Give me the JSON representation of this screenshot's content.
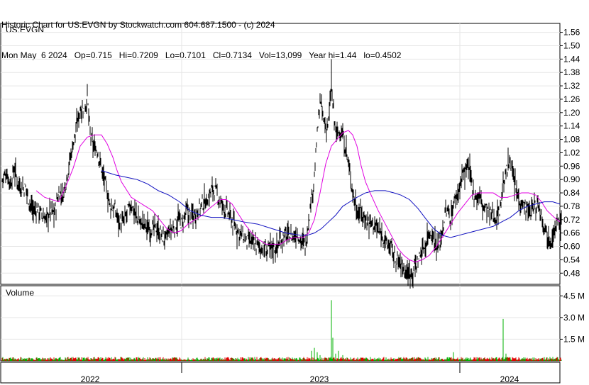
{
  "header": {
    "line1": "Historic Chart for US:EVGN by Stockwatch.com 604.687.1500 - (c) 2024",
    "line2": "Mon May  6 2024   Op=0.715   Hi=0.7209   Lo=0.7101   Cl=0.7134   Vol=13,099   Year hi=1.44   lo=0.4502"
  },
  "chart_data": [
    {
      "type": "ohlc",
      "title": "US:EVGN",
      "ylim": [
        0.43,
        1.6
      ],
      "y_ticks": [
        "1.56",
        "1.50",
        "1.44",
        "1.38",
        "1.32",
        "1.26",
        "1.20",
        "1.14",
        "1.08",
        "1.02",
        "0.96",
        "0.90",
        "0.84",
        "0.78",
        "0.72",
        "0.66",
        "0.60",
        "0.54",
        "0.48"
      ],
      "x_labels": [
        "2022",
        "2023",
        "2024"
      ],
      "moving_average_colors": {
        "short": "#e000e0",
        "long": "#1010c0"
      },
      "price_series": [
        [
          0,
          0.9
        ],
        [
          6,
          0.93
        ],
        [
          12,
          0.88
        ],
        [
          17,
          0.95
        ],
        [
          22,
          0.89
        ],
        [
          28,
          0.86
        ],
        [
          34,
          0.86
        ],
        [
          38,
          0.8
        ],
        [
          44,
          0.76
        ],
        [
          50,
          0.77
        ],
        [
          56,
          0.74
        ],
        [
          62,
          0.72
        ],
        [
          68,
          0.76
        ],
        [
          74,
          0.75
        ],
        [
          80,
          0.84
        ],
        [
          86,
          0.83
        ],
        [
          92,
          0.93
        ],
        [
          98,
          1.03
        ],
        [
          104,
          1.12
        ],
        [
          110,
          1.22
        ],
        [
          116,
          1.21
        ],
        [
          120,
          1.27
        ],
        [
          124,
          1.1
        ],
        [
          128,
          1.05
        ],
        [
          134,
          1.03
        ],
        [
          140,
          0.95
        ],
        [
          146,
          0.87
        ],
        [
          152,
          0.78
        ],
        [
          158,
          0.77
        ],
        [
          164,
          0.72
        ],
        [
          170,
          0.7
        ],
        [
          176,
          0.75
        ],
        [
          182,
          0.79
        ],
        [
          188,
          0.74
        ],
        [
          194,
          0.71
        ],
        [
          200,
          0.7
        ],
        [
          206,
          0.68
        ],
        [
          212,
          0.68
        ],
        [
          218,
          0.68
        ],
        [
          224,
          0.65
        ],
        [
          230,
          0.63
        ],
        [
          236,
          0.67
        ],
        [
          242,
          0.68
        ],
        [
          248,
          0.72
        ],
        [
          254,
          0.7
        ],
        [
          260,
          0.76
        ],
        [
          266,
          0.73
        ],
        [
          272,
          0.75
        ],
        [
          278,
          0.77
        ],
        [
          284,
          0.8
        ],
        [
          290,
          0.81
        ],
        [
          296,
          0.86
        ],
        [
          302,
          0.84
        ],
        [
          308,
          0.79
        ],
        [
          314,
          0.77
        ],
        [
          320,
          0.74
        ],
        [
          326,
          0.7
        ],
        [
          332,
          0.67
        ],
        [
          338,
          0.65
        ],
        [
          344,
          0.62
        ],
        [
          350,
          0.62
        ],
        [
          356,
          0.61
        ],
        [
          362,
          0.6
        ],
        [
          368,
          0.59
        ],
        [
          374,
          0.58
        ],
        [
          380,
          0.6
        ],
        [
          386,
          0.59
        ],
        [
          392,
          0.63
        ],
        [
          398,
          0.65
        ],
        [
          404,
          0.65
        ],
        [
          410,
          0.64
        ],
        [
          416,
          0.66
        ],
        [
          422,
          0.62
        ],
        [
          428,
          0.61
        ],
        [
          432,
          0.72
        ],
        [
          436,
          0.82
        ],
        [
          440,
          0.91
        ],
        [
          444,
          1.1
        ],
        [
          448,
          1.25
        ],
        [
          452,
          1.18
        ],
        [
          456,
          1.13
        ],
        [
          460,
          1.16
        ],
        [
          464,
          1.31
        ],
        [
          468,
          1.16
        ],
        [
          472,
          1.1
        ],
        [
          476,
          1.12
        ],
        [
          480,
          1.09
        ],
        [
          484,
          1.04
        ],
        [
          488,
          0.97
        ],
        [
          492,
          0.88
        ],
        [
          496,
          0.82
        ],
        [
          500,
          0.76
        ],
        [
          506,
          0.75
        ],
        [
          512,
          0.72
        ],
        [
          518,
          0.71
        ],
        [
          524,
          0.7
        ],
        [
          530,
          0.67
        ],
        [
          536,
          0.65
        ],
        [
          542,
          0.61
        ],
        [
          548,
          0.6
        ],
        [
          554,
          0.54
        ],
        [
          560,
          0.53
        ],
        [
          566,
          0.5
        ],
        [
          572,
          0.49
        ],
        [
          578,
          0.49
        ],
        [
          584,
          0.52
        ],
        [
          590,
          0.57
        ],
        [
          596,
          0.6
        ],
        [
          602,
          0.67
        ],
        [
          608,
          0.64
        ],
        [
          614,
          0.59
        ],
        [
          620,
          0.67
        ],
        [
          626,
          0.76
        ],
        [
          632,
          0.73
        ],
        [
          638,
          0.81
        ],
        [
          644,
          0.86
        ],
        [
          650,
          0.93
        ],
        [
          656,
          0.95
        ],
        [
          660,
          0.92
        ],
        [
          666,
          0.82
        ],
        [
          672,
          0.83
        ],
        [
          678,
          0.78
        ],
        [
          684,
          0.76
        ],
        [
          690,
          0.74
        ],
        [
          696,
          0.73
        ],
        [
          702,
          0.78
        ],
        [
          706,
          0.88
        ],
        [
          710,
          0.92
        ],
        [
          716,
          1.0
        ],
        [
          720,
          0.9
        ],
        [
          726,
          0.83
        ],
        [
          732,
          0.8
        ],
        [
          738,
          0.77
        ],
        [
          744,
          0.75
        ],
        [
          750,
          0.78
        ],
        [
          756,
          0.79
        ],
        [
          760,
          0.74
        ],
        [
          764,
          0.7
        ],
        [
          768,
          0.66
        ],
        [
          772,
          0.63
        ],
        [
          776,
          0.65
        ],
        [
          780,
          0.68
        ],
        [
          784,
          0.72
        ],
        [
          788,
          0.71
        ]
      ],
      "short_ma": [
        [
          48,
          0.85
        ],
        [
          60,
          0.82
        ],
        [
          70,
          0.81
        ],
        [
          80,
          0.8
        ],
        [
          90,
          0.87
        ],
        [
          100,
          0.95
        ],
        [
          110,
          1.05
        ],
        [
          120,
          1.09
        ],
        [
          130,
          1.1
        ],
        [
          140,
          1.1
        ],
        [
          148,
          1.06
        ],
        [
          156,
          1.0
        ],
        [
          162,
          0.94
        ],
        [
          168,
          0.89
        ],
        [
          174,
          0.86
        ],
        [
          182,
          0.82
        ],
        [
          192,
          0.8
        ],
        [
          202,
          0.78
        ],
        [
          212,
          0.76
        ],
        [
          222,
          0.72
        ],
        [
          232,
          0.68
        ],
        [
          242,
          0.66
        ],
        [
          252,
          0.67
        ],
        [
          262,
          0.7
        ],
        [
          272,
          0.72
        ],
        [
          282,
          0.74
        ],
        [
          292,
          0.77
        ],
        [
          300,
          0.79
        ],
        [
          308,
          0.81
        ],
        [
          316,
          0.81
        ],
        [
          324,
          0.79
        ],
        [
          332,
          0.75
        ],
        [
          342,
          0.7
        ],
        [
          352,
          0.66
        ],
        [
          362,
          0.63
        ],
        [
          372,
          0.61
        ],
        [
          382,
          0.61
        ],
        [
          392,
          0.61
        ],
        [
          402,
          0.63
        ],
        [
          412,
          0.64
        ],
        [
          424,
          0.64
        ],
        [
          432,
          0.66
        ],
        [
          440,
          0.72
        ],
        [
          448,
          0.84
        ],
        [
          456,
          0.97
        ],
        [
          464,
          1.05
        ],
        [
          472,
          1.08
        ],
        [
          480,
          1.11
        ],
        [
          488,
          1.12
        ],
        [
          494,
          1.1
        ],
        [
          500,
          1.05
        ],
        [
          506,
          0.96
        ],
        [
          512,
          0.89
        ],
        [
          520,
          0.83
        ],
        [
          530,
          0.76
        ],
        [
          540,
          0.7
        ],
        [
          550,
          0.64
        ],
        [
          558,
          0.59
        ],
        [
          566,
          0.56
        ],
        [
          574,
          0.54
        ],
        [
          582,
          0.53
        ],
        [
          592,
          0.54
        ],
        [
          602,
          0.56
        ],
        [
          612,
          0.6
        ],
        [
          622,
          0.65
        ],
        [
          632,
          0.7
        ],
        [
          642,
          0.75
        ],
        [
          652,
          0.79
        ],
        [
          662,
          0.83
        ],
        [
          672,
          0.84
        ],
        [
          682,
          0.84
        ],
        [
          692,
          0.84
        ],
        [
          702,
          0.82
        ],
        [
          712,
          0.82
        ],
        [
          722,
          0.83
        ],
        [
          732,
          0.84
        ],
        [
          742,
          0.84
        ],
        [
          752,
          0.83
        ],
        [
          760,
          0.8
        ],
        [
          768,
          0.76
        ],
        [
          778,
          0.73
        ],
        [
          786,
          0.71
        ]
      ],
      "long_ma": [
        [
          140,
          0.94
        ],
        [
          150,
          0.93
        ],
        [
          160,
          0.92
        ],
        [
          175,
          0.91
        ],
        [
          190,
          0.9
        ],
        [
          205,
          0.88
        ],
        [
          220,
          0.85
        ],
        [
          235,
          0.83
        ],
        [
          250,
          0.8
        ],
        [
          265,
          0.76
        ],
        [
          280,
          0.74
        ],
        [
          295,
          0.73
        ],
        [
          310,
          0.73
        ],
        [
          325,
          0.72
        ],
        [
          340,
          0.71
        ],
        [
          360,
          0.7
        ],
        [
          380,
          0.68
        ],
        [
          400,
          0.66
        ],
        [
          420,
          0.65
        ],
        [
          430,
          0.65
        ],
        [
          440,
          0.66
        ],
        [
          450,
          0.68
        ],
        [
          460,
          0.71
        ],
        [
          470,
          0.74
        ],
        [
          480,
          0.78
        ],
        [
          490,
          0.8
        ],
        [
          500,
          0.82
        ],
        [
          512,
          0.84
        ],
        [
          525,
          0.85
        ],
        [
          540,
          0.85
        ],
        [
          552,
          0.84
        ],
        [
          562,
          0.83
        ],
        [
          574,
          0.81
        ],
        [
          586,
          0.77
        ],
        [
          598,
          0.72
        ],
        [
          608,
          0.68
        ],
        [
          620,
          0.65
        ],
        [
          632,
          0.64
        ],
        [
          644,
          0.65
        ],
        [
          656,
          0.66
        ],
        [
          668,
          0.67
        ],
        [
          680,
          0.68
        ],
        [
          692,
          0.69
        ],
        [
          704,
          0.71
        ],
        [
          716,
          0.73
        ],
        [
          728,
          0.76
        ],
        [
          740,
          0.78
        ],
        [
          752,
          0.79
        ],
        [
          764,
          0.8
        ],
        [
          776,
          0.8
        ],
        [
          786,
          0.79
        ]
      ]
    },
    {
      "type": "bar",
      "title": "Volume",
      "ylim": [
        0,
        5.2
      ],
      "y_ticks": [
        "4.5 M",
        "3.0 M",
        "1.5 M"
      ],
      "spikes": [
        [
          436,
          0.7
        ],
        [
          440,
          0.9
        ],
        [
          444,
          0.6
        ],
        [
          448,
          0.4
        ],
        [
          464,
          4.2
        ],
        [
          466,
          1.6
        ],
        [
          470,
          0.5
        ],
        [
          474,
          0.7
        ],
        [
          480,
          0.4
        ],
        [
          636,
          0.6
        ],
        [
          706,
          2.9
        ],
        [
          710,
          0.5
        ]
      ],
      "colors": {
        "up": "#00b000",
        "down": "#e00000"
      }
    }
  ]
}
